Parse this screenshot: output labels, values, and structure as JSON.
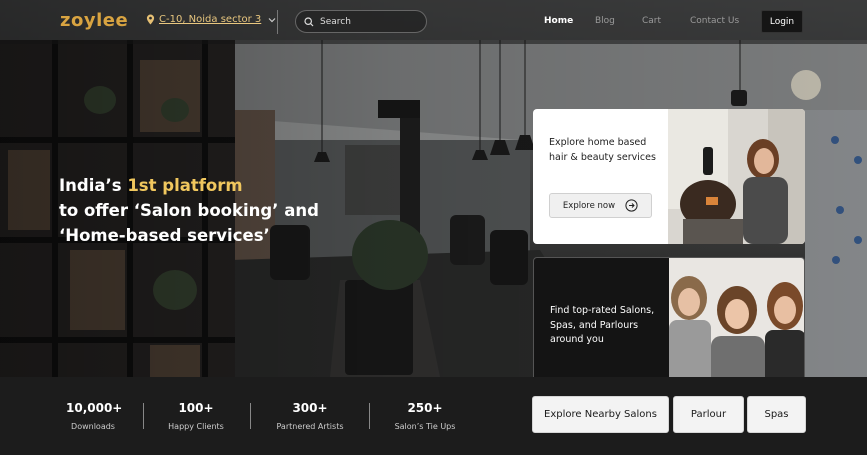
{
  "brand": {
    "logo": "zoylee",
    "accent": "#d9a441"
  },
  "location": {
    "icon": "pin-icon",
    "text": "C-10, Noida sector 3"
  },
  "search": {
    "placeholder": "Search",
    "icon": "search-icon"
  },
  "nav": {
    "links": [
      "Home",
      "Blog",
      "Cart",
      "Contact Us"
    ],
    "active": "Home",
    "login": "Login"
  },
  "hero": {
    "line1_pre": "India’s ",
    "line1_highlight": "1st platform",
    "line2": "to offer ‘Salon booking’ and",
    "line3": "‘Home-based services’"
  },
  "card_home": {
    "title": "Explore home based hair & beauty services",
    "button": "Explore now",
    "button_icon": "arrow-right-circle-icon"
  },
  "card_salons": {
    "title": "Find top-rated Salons, Spas, and Parlours around you"
  },
  "stats": [
    {
      "value": "10,000+",
      "label": "Downloads"
    },
    {
      "value": "100+",
      "label": "Happy Clients"
    },
    {
      "value": "300+",
      "label": "Partnered Artists"
    },
    {
      "value": "250+",
      "label": "Salon’s Tie Ups"
    }
  ],
  "actions": {
    "nearby": "Explore Nearby Salons",
    "parlour": "Parlour",
    "spas": "Spas"
  }
}
